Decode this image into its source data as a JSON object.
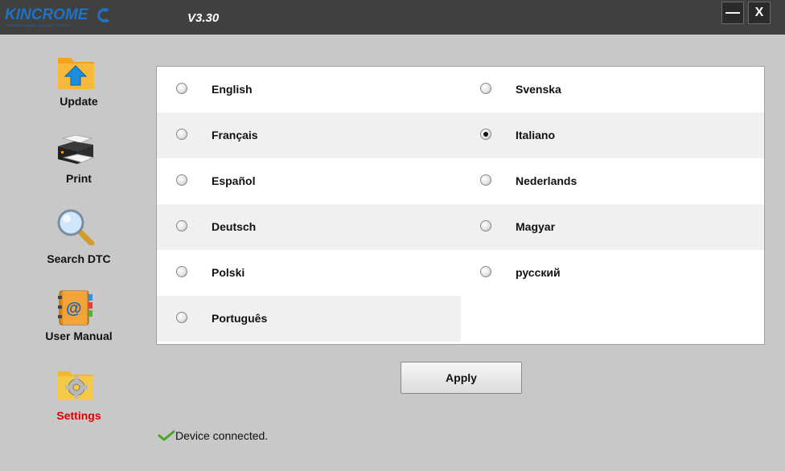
{
  "app": {
    "logo_text": "KINCROME",
    "logo_tagline": "PROFESSIONAL QUALITY TOOLS",
    "version": "V3.30",
    "window_controls": {
      "minimize_label": "—",
      "close_label": "X"
    }
  },
  "sidebar": {
    "items": [
      {
        "label": "Update",
        "icon": "folder-upload-icon",
        "active": false
      },
      {
        "label": "Print",
        "icon": "printer-icon",
        "active": false
      },
      {
        "label": "Search DTC",
        "icon": "magnifier-icon",
        "active": false
      },
      {
        "label": "User Manual",
        "icon": "address-book-icon",
        "active": false
      },
      {
        "label": "Settings",
        "icon": "gear-folder-icon",
        "active": true
      }
    ]
  },
  "languages": {
    "options": [
      {
        "label": "English",
        "selected": false
      },
      {
        "label": "Svenska",
        "selected": false
      },
      {
        "label": "Français",
        "selected": false
      },
      {
        "label": "Italiano",
        "selected": true
      },
      {
        "label": "Español",
        "selected": false
      },
      {
        "label": "Nederlands",
        "selected": false
      },
      {
        "label": "Deutsch",
        "selected": false
      },
      {
        "label": "Magyar",
        "selected": false
      },
      {
        "label": "Polski",
        "selected": false
      },
      {
        "label": "русский",
        "selected": false
      },
      {
        "label": "Português",
        "selected": false
      }
    ]
  },
  "apply_label": "Apply",
  "status": {
    "text": "Device connected.",
    "icon": "checkmark-icon"
  },
  "colors": {
    "titlebar": "#404040",
    "background": "#c8c8c8",
    "logo": "#1e73c8",
    "active_item": "#e00000",
    "status_check": "#44aa22"
  }
}
